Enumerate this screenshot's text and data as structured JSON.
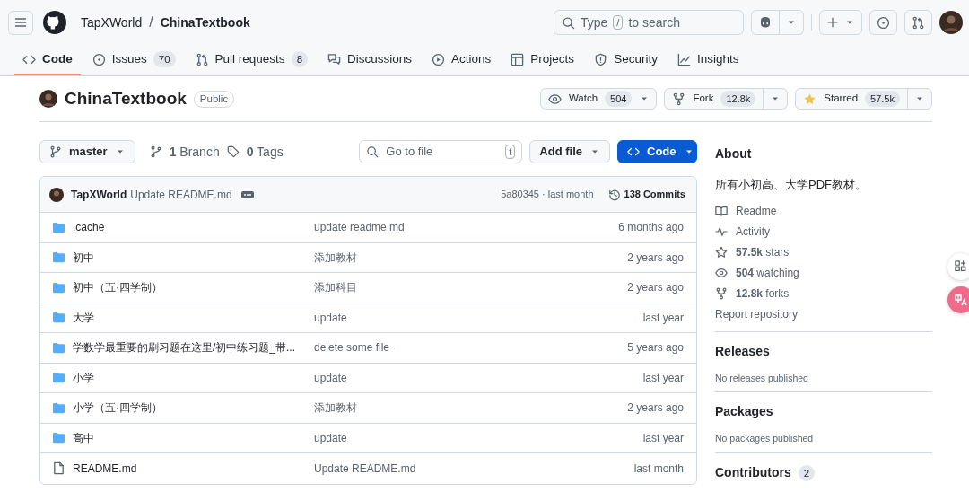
{
  "header": {
    "owner": "TapXWorld",
    "separator": "/",
    "repo": "ChinaTextbook",
    "search": {
      "before": "Type",
      "key": "/",
      "after": "to search"
    }
  },
  "tabs": [
    {
      "label": "Code",
      "selected": true
    },
    {
      "label": "Issues",
      "count": "70",
      "selected": false
    },
    {
      "label": "Pull requests",
      "count": "8",
      "selected": false
    },
    {
      "label": "Discussions",
      "selected": false
    },
    {
      "label": "Actions",
      "selected": false
    },
    {
      "label": "Projects",
      "selected": false
    },
    {
      "label": "Security",
      "selected": false
    },
    {
      "label": "Insights",
      "selected": false
    }
  ],
  "repo": {
    "name": "ChinaTextbook",
    "visibility": "Public",
    "watch": {
      "label": "Watch",
      "count": "504"
    },
    "fork": {
      "label": "Fork",
      "count": "12.8k"
    },
    "star": {
      "label": "Starred",
      "count": "57.5k",
      "starred": true
    }
  },
  "toolbar": {
    "branch": "master",
    "branches": "**1** Branch",
    "tags": "**0** Tags",
    "goto": {
      "placeholder": "Go to file",
      "key": "t"
    },
    "add_file": "Add file",
    "code": "Code"
  },
  "commit": {
    "author": "TapXWorld",
    "message": "Update README.md",
    "hash_time": "5a80345 · last month",
    "commits": "138 Commits"
  },
  "files": [
    {
      "kind": "folder",
      "name": ".cache",
      "message": "update readme.md",
      "time": "6 months ago"
    },
    {
      "kind": "folder",
      "name": "初中",
      "message": "添加教材",
      "time": "2 years ago"
    },
    {
      "kind": "folder",
      "name": "初中（五·四学制）",
      "message": "添加科目",
      "time": "2 years ago"
    },
    {
      "kind": "folder",
      "name": "大学",
      "message": "update",
      "time": "last year"
    },
    {
      "kind": "folder",
      "name": "学数学最重要的刷习题在这里/初中练习题_带...",
      "message": "delete some file",
      "time": "5 years ago"
    },
    {
      "kind": "folder",
      "name": "小学",
      "message": "update",
      "time": "last year"
    },
    {
      "kind": "folder",
      "name": "小学（五·四学制）",
      "message": "添加教材",
      "time": "2 years ago"
    },
    {
      "kind": "folder",
      "name": "高中",
      "message": "update",
      "time": "last year"
    },
    {
      "kind": "file",
      "name": "README.md",
      "message": "Update README.md",
      "time": "last month"
    }
  ],
  "about": {
    "title": "About",
    "description": "所有小初高、大学PDF教材。",
    "links": [
      {
        "kind": "readme",
        "text": "Readme"
      },
      {
        "kind": "activity",
        "text": "Activity"
      },
      {
        "kind": "stars",
        "text": "**57.5k** stars"
      },
      {
        "kind": "watching",
        "text": "**504** watching"
      },
      {
        "kind": "forks",
        "text": "**12.8k** forks"
      }
    ],
    "report": "Report repository"
  },
  "sections": [
    {
      "title": "Releases",
      "note": "No releases published"
    },
    {
      "title": "Packages",
      "note": "No packages published"
    },
    {
      "title": "Contributors",
      "count": "2"
    }
  ]
}
